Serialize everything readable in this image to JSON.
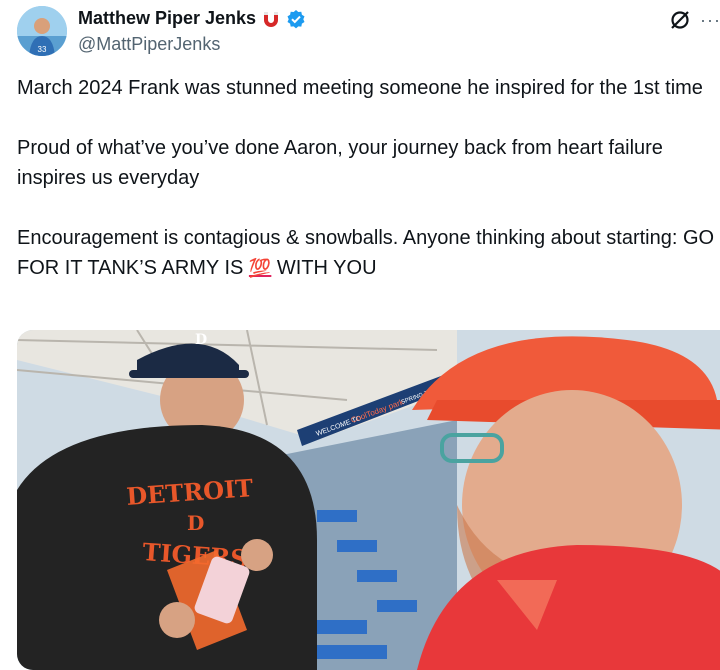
{
  "author": {
    "display_name": "Matthew Piper Jenks",
    "handle": "@MattPiperJenks",
    "verified_badge": "verified-badge-icon",
    "affiliate_icon": "magnet-icon",
    "avatar_jersey_number": "33"
  },
  "header_actions": {
    "grok_icon": "grok-icon",
    "more_label": "···"
  },
  "tweet": {
    "paragraph1": "March 2024 Frank was stunned meeting someone he inspired for the 1st time",
    "paragraph2": "Proud of what’ve you’ve done Aaron, your journey back from heart failure inspires us everyday",
    "paragraph3_before": "Encouragement is contagious & snowballs. Anyone thinking about starting: GO FOR IT TANK’S ARMY IS ",
    "paragraph3_emoji": "💯",
    "paragraph3_after": " WITH YOU"
  },
  "media": {
    "shirt_line1": "DETROIT",
    "shirt_letter": "D",
    "shirt_line2": "TIGERS",
    "cap_letter": "D",
    "stadium_sign": "WELCOME TO",
    "stadium_brand": "CoolToday park",
    "stadium_sign_2": "SPRING TRAINING HOME OF"
  },
  "colors": {
    "verified": "#1d9bf0",
    "text": "#0f1419",
    "muted": "#536471",
    "emoji_red": "#e0245e"
  }
}
